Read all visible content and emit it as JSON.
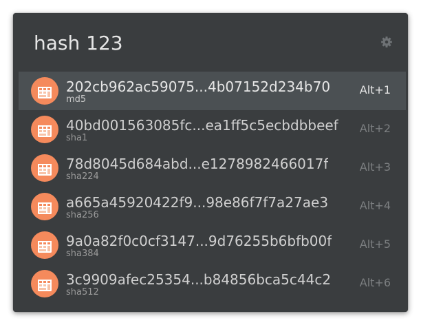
{
  "query": "hash 123",
  "settings_icon": "gear-icon",
  "item_icon": "calculator-icon",
  "colors": {
    "window_bg": "#3a3d3f",
    "selected_row_bg": "#4b5053",
    "icon_accent": "#f58a5c"
  },
  "results": [
    {
      "hash": "202cb962ac59075...4b07152d234b70",
      "algorithm": "md5",
      "shortcut": "Alt+1",
      "selected": true
    },
    {
      "hash": "40bd001563085fc...ea1ff5c5ecbdbbeef",
      "algorithm": "sha1",
      "shortcut": "Alt+2",
      "selected": false
    },
    {
      "hash": "78d8045d684abd...e1278982466017f",
      "algorithm": "sha224",
      "shortcut": "Alt+3",
      "selected": false
    },
    {
      "hash": "a665a45920422f9...98e86f7f7a27ae3",
      "algorithm": "sha256",
      "shortcut": "Alt+4",
      "selected": false
    },
    {
      "hash": "9a0a82f0c0cf3147...9d76255b6bfb00f",
      "algorithm": "sha384",
      "shortcut": "Alt+5",
      "selected": false
    },
    {
      "hash": "3c9909afec25354...b84856bca5c44c2",
      "algorithm": "sha512",
      "shortcut": "Alt+6",
      "selected": false
    }
  ]
}
